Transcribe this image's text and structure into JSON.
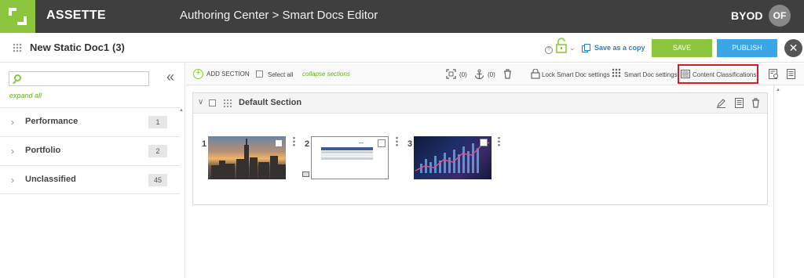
{
  "topbar": {
    "brand": "ASSETTE",
    "breadcrumb": "Authoring Center > Smart Docs Editor",
    "tenant": "BYOD",
    "avatar_initials": "OF",
    "bg_color": "#3f3f3f",
    "logo_color": "#8cc63f"
  },
  "docbar": {
    "title": "New Static Doc1",
    "count": "(3)",
    "save_as_copy": "Save as a copy",
    "save_label": "SAVE",
    "publish_label": "PUBLISH",
    "close_label": "✕"
  },
  "left": {
    "search_placeholder": "",
    "expand_all": "expand all",
    "categories": [
      {
        "label": "Performance",
        "count": "1"
      },
      {
        "label": "Portfolio",
        "count": "2"
      },
      {
        "label": "Unclassified",
        "count": "45"
      }
    ]
  },
  "toolbar": {
    "add_section": "ADD SECTION",
    "select_all": "Select all",
    "collapse_sections": "collapse sections",
    "count_a": "(0)",
    "count_b": "(0)",
    "lock_settings": "Lock Smart Doc settings",
    "smart_doc_settings": "Smart Doc settings",
    "content_classifications": "Content Classifications",
    "highlight_color": "#d11f28"
  },
  "section": {
    "title": "Default Section",
    "items": [
      {
        "number": "1",
        "icon": "city-skyline-thumbnail"
      },
      {
        "number": "2",
        "icon": "table-document-thumbnail"
      },
      {
        "number": "3",
        "icon": "financial-chart-thumbnail"
      }
    ]
  },
  "colors": {
    "accent_green": "#8cc63f",
    "accent_blue": "#3aa6e6",
    "link_blue": "#2a7fc8"
  }
}
